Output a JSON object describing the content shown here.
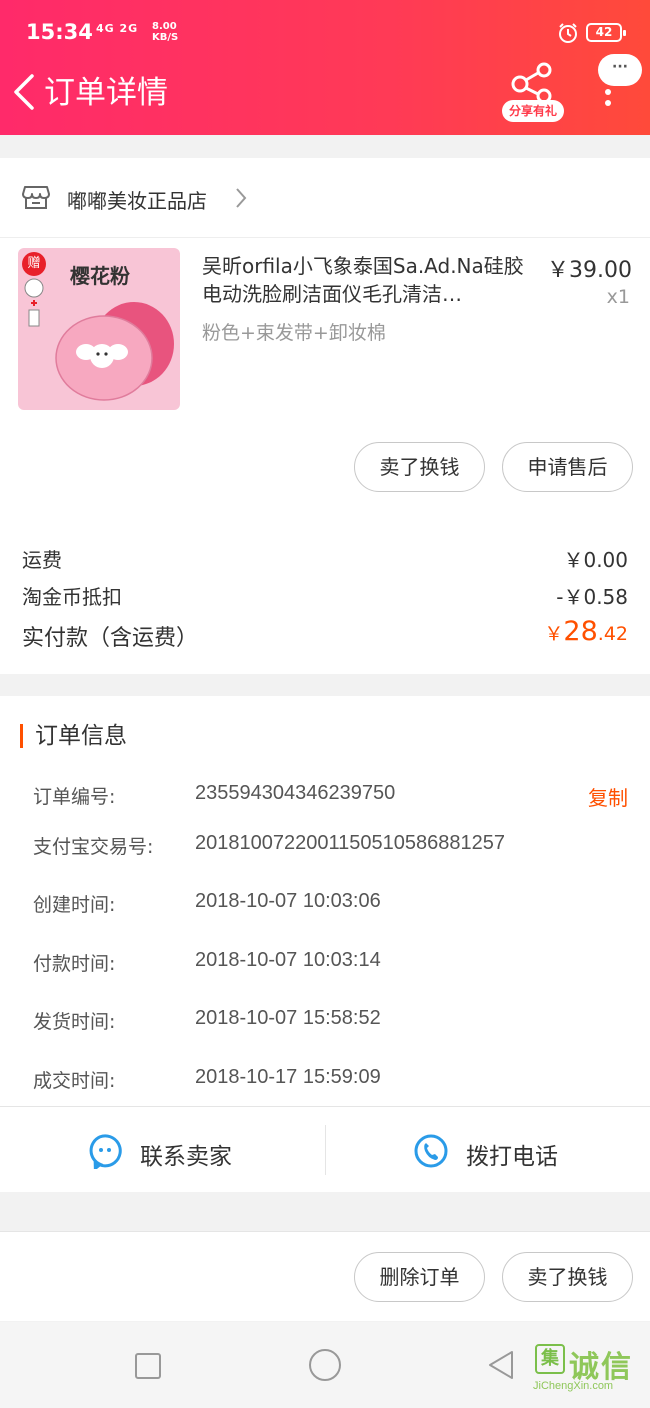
{
  "status_bar": {
    "time": "15:34",
    "signal": "4G 2G",
    "net_speed_value": "8.00",
    "net_speed_unit": "KB/S",
    "battery": "42"
  },
  "header": {
    "title": "订单详情",
    "share_label": "分享有礼",
    "more_label": "···"
  },
  "shop": {
    "name": "嘟嘟美妆正品店"
  },
  "product": {
    "image_label": "樱花粉",
    "gift_badge": "赠",
    "name": "吴昕orfila小飞象泰国Sa.Ad.Na硅胶电动洗脸刷洁面仪毛孔清洁…",
    "price": "￥39.00",
    "quantity": "x1",
    "sku": "粉色+束发带+卸妆棉"
  },
  "item_actions": {
    "sell_label": "卖了换钱",
    "aftersale_label": "申请售后"
  },
  "fees": {
    "shipping_label": "运费",
    "shipping_value": "￥0.00",
    "coin_label": "淘金币抵扣",
    "coin_value": "-￥0.58",
    "total_label": "实付款（含运费）",
    "total_yen": "￥",
    "total_int": "28",
    "total_dec": ".42"
  },
  "order_info": {
    "title": "订单信息",
    "copy_label": "复制",
    "rows": [
      {
        "label": "订单编号:",
        "value": "235594304346239750"
      },
      {
        "label": "支付宝交易号:",
        "value": "2018100722001150510586881257"
      },
      {
        "label": "创建时间:",
        "value": "2018-10-07 10:03:06"
      },
      {
        "label": "付款时间:",
        "value": "2018-10-07 10:03:14"
      },
      {
        "label": "发货时间:",
        "value": "2018-10-07 15:58:52"
      },
      {
        "label": "成交时间:",
        "value": "2018-10-17 15:59:09"
      }
    ]
  },
  "contact": {
    "seller_label": "联系卖家",
    "phone_label": "拨打电话"
  },
  "bottom_actions": {
    "delete_label": "删除订单",
    "sell_label": "卖了换钱"
  },
  "watermark": {
    "badge": "集",
    "text": "诚信",
    "url": "JiChengXin.com"
  },
  "colors": {
    "header_start": "#ff2a6a",
    "header_end": "#ff4a3a",
    "accent": "#ff5000",
    "icon_blue": "#2a9be8"
  }
}
